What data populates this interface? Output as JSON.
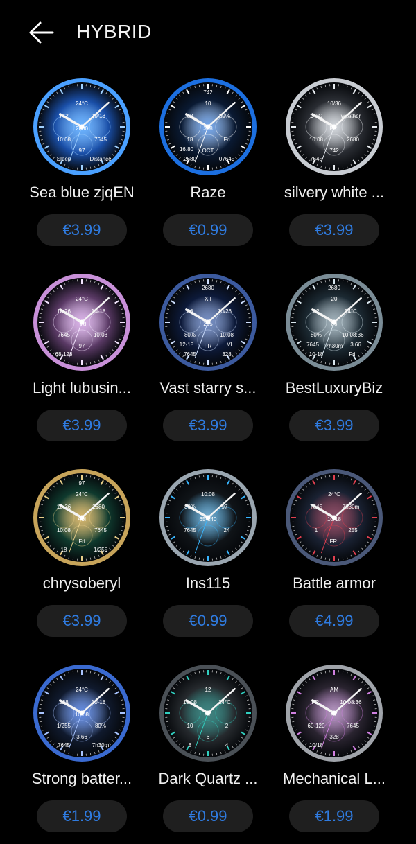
{
  "header": {
    "title": "HYBRID",
    "back_icon": "arrow-left-icon"
  },
  "colors": {
    "background": "#000000",
    "price_text": "#2f7be0",
    "price_pill": "#1f1f1f"
  },
  "items": [
    {
      "name": "Sea blue zjqEN",
      "price": "€3.99",
      "face": {
        "bg": "#1a4fa8",
        "ring": "#4aa0ff",
        "accent": "#9fd0ff",
        "texts": [
          "24°C",
          "742",
          "10/18",
          "2680",
          "10:08",
          "7645",
          "97",
          "Sleep",
          "Distance"
        ]
      }
    },
    {
      "name": "Raze",
      "price": "€0.99",
      "face": {
        "bg": "#0a1a33",
        "ring": "#1c6fe0",
        "accent": "#ffffff",
        "texts": [
          "10",
          "08",
          "80%",
          "328",
          "18",
          "Fri",
          "OCT",
          "2680",
          "07645",
          "742",
          "16.80"
        ]
      }
    },
    {
      "name": "silvery white ...",
      "price": "€3.99",
      "face": {
        "bg": "#2a2d33",
        "ring": "#c8ccd2",
        "accent": "#e8ecf0",
        "texts": [
          "10/36",
          "24°C",
          "weather",
          "FRI",
          "10:08",
          "2680",
          "742",
          "7645"
        ]
      }
    },
    {
      "name": "Light lubusin...",
      "price": "€3.99",
      "face": {
        "bg": "#5b3a66",
        "ring": "#c890d8",
        "accent": "#f4e6ff",
        "texts": [
          "24°C",
          "16/26",
          "10-18",
          "FRI",
          "7645",
          "10:08",
          "97",
          "68-128"
        ]
      }
    },
    {
      "name": "Vast starry s...",
      "price": "€3.99",
      "face": {
        "bg": "#0d1a3a",
        "ring": "#3c5a9e",
        "accent": "#cfe0ff",
        "texts": [
          "XII",
          "36",
          "10/26",
          "255",
          "80%",
          "10:08",
          "FR",
          "7645",
          "328",
          "2680",
          "12-18",
          "VI"
        ]
      }
    },
    {
      "name": "BestLuxuryBiz",
      "price": "€3.99",
      "face": {
        "bg": "#1c2a33",
        "ring": "#7a8c96",
        "accent": "#d8e6ee",
        "texts": [
          "20",
          "22",
          "24°C",
          "86",
          "80%",
          "10:08:36",
          "7h30m",
          "10-18",
          "Fri.",
          "2680",
          "7645",
          "3.66"
        ]
      }
    },
    {
      "name": "chrysoberyl",
      "price": "€3.99",
      "face": {
        "bg": "#0f3a2e",
        "ring": "#c7a45a",
        "accent": "#e8cf8a",
        "texts": [
          "24°C",
          "10-36",
          "2680",
          "AM",
          "10:08",
          "7645",
          "Fri",
          "18",
          "1/255",
          "97"
        ]
      }
    },
    {
      "name": "Ins115",
      "price": "€0.99",
      "face": {
        "bg": "#101418",
        "ring": "#9aa6b0",
        "accent": "#39b6ff",
        "texts": [
          "10:08",
          "80%",
          "97",
          "65-140",
          "7645",
          "24"
        ]
      }
    },
    {
      "name": "Battle armor",
      "price": "€4.99",
      "face": {
        "bg": "#1a2233",
        "ring": "#4a5878",
        "accent": "#e04050",
        "texts": [
          "24°C",
          "7645",
          "7h30m",
          "10/18",
          "1",
          "255",
          "FRI"
        ]
      }
    },
    {
      "name": "Strong batter...",
      "price": "€1.99",
      "face": {
        "bg": "#101a2e",
        "ring": "#3a6ad0",
        "accent": "#a8c4ff",
        "texts": [
          "24°C",
          "328",
          "10-18",
          "10:08",
          "1/255",
          "80%",
          "3.66",
          "7645",
          "7h30m"
        ]
      }
    },
    {
      "name": "Dark Quartz ...",
      "price": "€0.99",
      "face": {
        "bg": "#262a2e",
        "ring": "#4a5056",
        "accent": "#30d0c0",
        "texts": [
          "12",
          "10:08",
          "24°C",
          "97",
          "10",
          "2",
          "6",
          "8",
          "4"
        ]
      }
    },
    {
      "name": "Mechanical L...",
      "price": "€1.99",
      "face": {
        "bg": "#2a2430",
        "ring": "#a0a4aa",
        "accent": "#d080e0",
        "texts": [
          "AM",
          "FRI",
          "10:08:36",
          "97",
          "60-120",
          "7645",
          "328",
          "10/18"
        ]
      }
    }
  ]
}
